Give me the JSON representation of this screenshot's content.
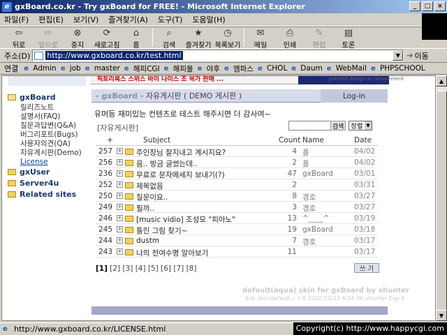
{
  "window": {
    "title": "gxBoard.co.kr - Try gxBoard for FREE! - Microsoft Internet Explorer"
  },
  "menu": [
    "파일(F)",
    "편집(E)",
    "보기(V)",
    "즐겨찾기(A)",
    "도구(T)",
    "도움말(H)"
  ],
  "toolbar": [
    {
      "label": "뒤로",
      "icon": "back-arrow-icon",
      "enabled": true
    },
    {
      "label": "앞으로",
      "icon": "forward-arrow-icon",
      "enabled": false
    },
    {
      "label": "중지",
      "icon": "stop-icon",
      "enabled": true
    },
    {
      "label": "새로고침",
      "icon": "refresh-icon",
      "enabled": true
    },
    {
      "label": "홈",
      "icon": "home-icon",
      "enabled": true
    },
    {
      "label": "검색",
      "icon": "search-icon",
      "enabled": true
    },
    {
      "label": "즐겨찾기",
      "icon": "favorites-icon",
      "enabled": true
    },
    {
      "label": "목록보기",
      "icon": "history-icon",
      "enabled": true
    },
    {
      "label": "메일",
      "icon": "mail-icon",
      "enabled": true
    },
    {
      "label": "인쇄",
      "icon": "print-icon",
      "enabled": true
    },
    {
      "label": "편집",
      "icon": "edit-icon",
      "enabled": false
    },
    {
      "label": "토론",
      "icon": "discuss-icon",
      "enabled": true
    }
  ],
  "address": {
    "label": "주소(D)",
    "url": "http://www.gxboard.co.kr/test.html",
    "go_label": "이동"
  },
  "links": {
    "label": "연결",
    "items": [
      "Admin",
      "job",
      "master",
      "해피CGI",
      "해피몰",
      "야후",
      "엠파스",
      "CHOL",
      "Daum",
      "WebMail",
      "PHPSCHOOL"
    ]
  },
  "nav": {
    "tree": [
      {
        "label": "gxBoard",
        "open": true,
        "children": [
          "릴리즈노트",
          "설명서(FAQ)",
          "질문과답변(Q&A)",
          "버그리포트(Bugs)",
          "사용자의견(QA)",
          "자유게시판(Demo)",
          "License"
        ]
      },
      {
        "label": "gxUser",
        "open": false,
        "children": []
      },
      {
        "label": "Server4u",
        "open": false,
        "children": []
      },
      {
        "label": "Related sites",
        "open": false,
        "children": []
      }
    ]
  },
  "header": {
    "brand": "- gxBoard -",
    "title": "자유게시판 ( DEMO 게시판 )",
    "login": "Log-in"
  },
  "banner": {
    "text": "픽토리룩스 스위스 바이 나이스 조 목가 판매 ...",
    "sub": "pointed design an amusement"
  },
  "intro": "유머등 재미있는 컨텐츠로 테스트 해주시면 더 감사여~",
  "board_name": "[자유게시판]",
  "search_button": "검색",
  "sort_label": "정렬",
  "columns": [
    "+",
    "Subject",
    "Count",
    "Name",
    "Date"
  ],
  "rows": [
    {
      "no": "257",
      "subject": "주인장님 잘지내고 계시지요?",
      "count": "4",
      "name": "폴",
      "date": "04/02"
    },
    {
      "no": "256",
      "subject": "음.. 방금 글썼는데..",
      "count": "2",
      "name": "폴",
      "date": "04/02"
    },
    {
      "no": "236",
      "subject": "무료로 문자메세지 보내기(?)",
      "count": "47",
      "name": "gxBoard",
      "date": "03/01"
    },
    {
      "no": "252",
      "subject": "제목없음",
      "count": "2",
      "name": "",
      "date": "03/31"
    },
    {
      "no": "250",
      "subject": "질문이요..",
      "count": "8",
      "name": "경호",
      "date": "03/27"
    },
    {
      "no": "249",
      "subject": "필까..",
      "count": "3",
      "name": "경호",
      "date": "03/27"
    },
    {
      "no": "246",
      "subject": "[music vidio] 조성모 \"피아노\"",
      "count": "13",
      "name": "^____^",
      "date": "03/19"
    },
    {
      "no": "245",
      "subject": "틀린 그림 찾기~",
      "count": "19",
      "name": "gxBoard",
      "date": "03/18"
    },
    {
      "no": "244",
      "subject": "dustm",
      "count": "7",
      "name": "경호",
      "date": "03/17"
    },
    {
      "no": "243",
      "subject": "나의 전여수명 알아보기",
      "count": "11",
      "name": "",
      "date": "03/17"
    }
  ],
  "pages": {
    "current": "[1]",
    "others": [
      "[2]",
      "[3]",
      "[4]",
      "[5]",
      "[6]",
      "[7]",
      "[8]"
    ]
  },
  "write_button": "쓰 기",
  "footer": {
    "line1": "default(aqua) skin for gxBoard by xhunter",
    "line2": "$Id: skin/default,v 1.0 2002/12/12 4:04:36 xhunter Exp $"
  },
  "status": {
    "url": "http://www.gxboard.co.kr/LICENSE.html",
    "copyright": "Copyright(c) http://www.happycgi.com"
  }
}
